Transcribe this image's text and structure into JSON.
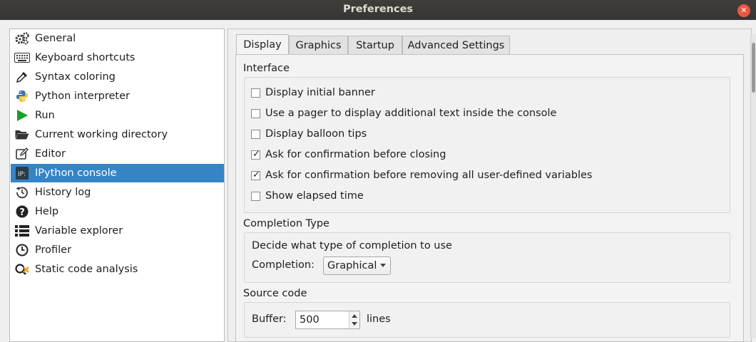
{
  "window": {
    "title": "Preferences"
  },
  "sidebar": {
    "items": [
      {
        "label": "General",
        "icon": "gears-icon"
      },
      {
        "label": "Keyboard shortcuts",
        "icon": "keyboard-icon"
      },
      {
        "label": "Syntax coloring",
        "icon": "eyedropper-icon"
      },
      {
        "label": "Python interpreter",
        "icon": "python-icon"
      },
      {
        "label": "Run",
        "icon": "play-icon"
      },
      {
        "label": "Current working directory",
        "icon": "folder-open-icon"
      },
      {
        "label": "Editor",
        "icon": "edit-icon"
      },
      {
        "label": "IPython console",
        "icon": "ipython-icon",
        "selected": true
      },
      {
        "label": "History log",
        "icon": "history-icon"
      },
      {
        "label": "Help",
        "icon": "help-icon"
      },
      {
        "label": "Variable explorer",
        "icon": "list-icon"
      },
      {
        "label": "Profiler",
        "icon": "clock-icon"
      },
      {
        "label": "Static code analysis",
        "icon": "code-analysis-icon"
      }
    ]
  },
  "tabs": [
    {
      "label": "Display",
      "active": true
    },
    {
      "label": "Graphics"
    },
    {
      "label": "Startup"
    },
    {
      "label": "Advanced Settings"
    }
  ],
  "interface": {
    "title": "Interface",
    "options": [
      {
        "label": "Display initial banner",
        "checked": false
      },
      {
        "label": "Use a pager to display additional text inside the console",
        "checked": false
      },
      {
        "label": "Display balloon tips",
        "checked": false
      },
      {
        "label": "Ask for confirmation before closing",
        "checked": true
      },
      {
        "label": "Ask for confirmation before removing all user-defined variables",
        "checked": true
      },
      {
        "label": "Show elapsed time",
        "checked": false
      }
    ]
  },
  "completion": {
    "title": "Completion Type",
    "description": "Decide what type of completion to use",
    "label": "Completion:",
    "value": "Graphical"
  },
  "source_code": {
    "title": "Source code",
    "buffer_label": "Buffer:",
    "buffer_value": "500",
    "buffer_unit": "lines"
  },
  "colors": {
    "selection": "#3584c6",
    "titlebar": "#3a3937",
    "close": "#e9573f"
  }
}
